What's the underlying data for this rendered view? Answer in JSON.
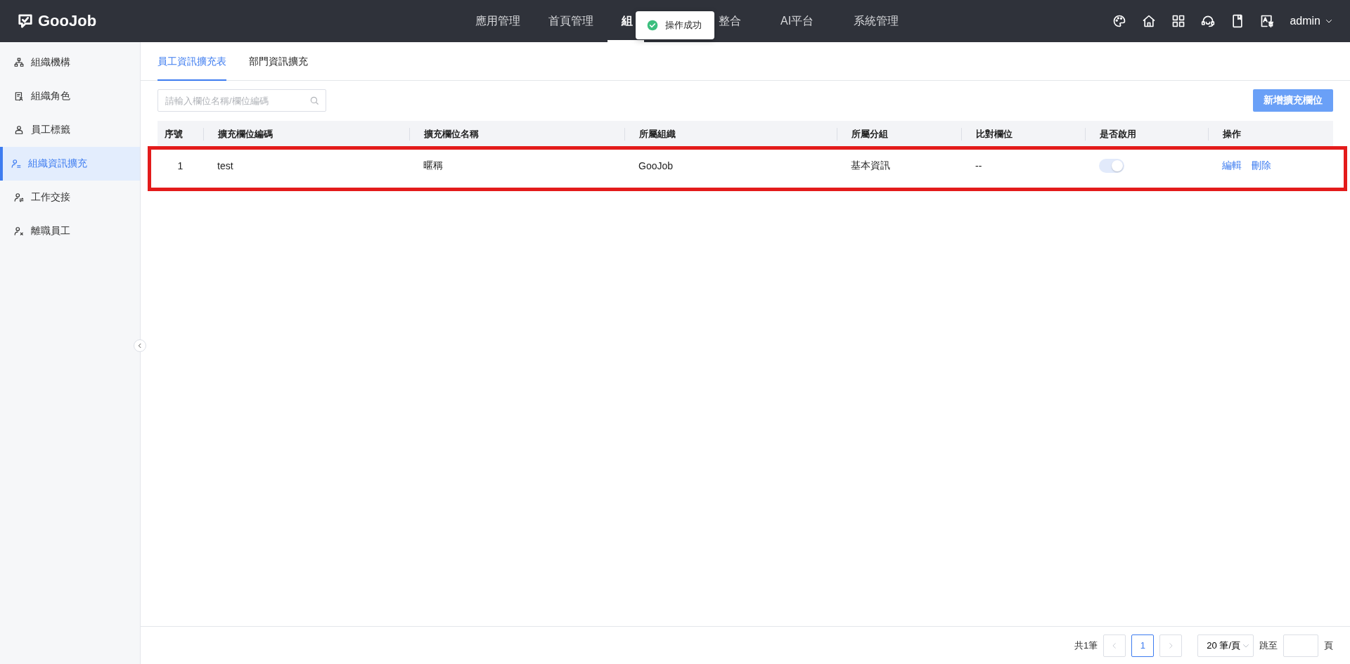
{
  "header": {
    "logo": "GooJob",
    "nav": [
      {
        "label": "應用管理",
        "selected": false
      },
      {
        "label": "首頁管理",
        "selected": false
      },
      {
        "label": "組",
        "selected": true
      },
      {
        "label": "整合",
        "selected": false
      },
      {
        "label": "AI平台",
        "selected": false
      },
      {
        "label": "系統管理",
        "selected": false
      }
    ],
    "tools": [
      {
        "kind": "palette"
      },
      {
        "kind": "home"
      },
      {
        "kind": "grid"
      },
      {
        "kind": "headset"
      },
      {
        "kind": "book"
      },
      {
        "kind": "translate"
      }
    ],
    "user": "admin"
  },
  "toast": {
    "message": "操作成功"
  },
  "sidebar": {
    "items": [
      {
        "label": "組織機構",
        "kind": "org",
        "selected": false
      },
      {
        "label": "組織角色",
        "kind": "role",
        "selected": false
      },
      {
        "label": "員工標籤",
        "kind": "tag",
        "selected": false
      },
      {
        "label": "組織資訊擴充",
        "kind": "list",
        "selected": true
      },
      {
        "label": "工作交接",
        "kind": "swap",
        "selected": false
      },
      {
        "label": "離職員工",
        "kind": "remove",
        "selected": false
      }
    ]
  },
  "tabs": [
    {
      "label": "員工資訊擴充表",
      "selected": true
    },
    {
      "label": "部門資訊擴充",
      "selected": false
    }
  ],
  "search": {
    "placeholder": "請輸入欄位名稱/欄位編碼"
  },
  "add_button": "新增擴充欄位",
  "table": {
    "columns": [
      "序號",
      "擴充欄位編碼",
      "擴充欄位名稱",
      "所屬組織",
      "所屬分組",
      "比對欄位",
      "是否啟用",
      "操作"
    ],
    "rows": [
      {
        "index": "1",
        "code": "test",
        "name": "暱稱",
        "org": "GooJob",
        "group": "基本資訊",
        "compare": "--",
        "enabled": {
          "on": true,
          "disabled": true
        },
        "actions": [
          "編輯",
          "刪除"
        ],
        "highlighted": true
      }
    ]
  },
  "pagination": {
    "total": "共1筆",
    "pages": [
      {
        "label": "1",
        "selected": true
      }
    ],
    "page_size": "20 筆/頁",
    "jump_label": "跳至",
    "page_unit": "頁"
  }
}
